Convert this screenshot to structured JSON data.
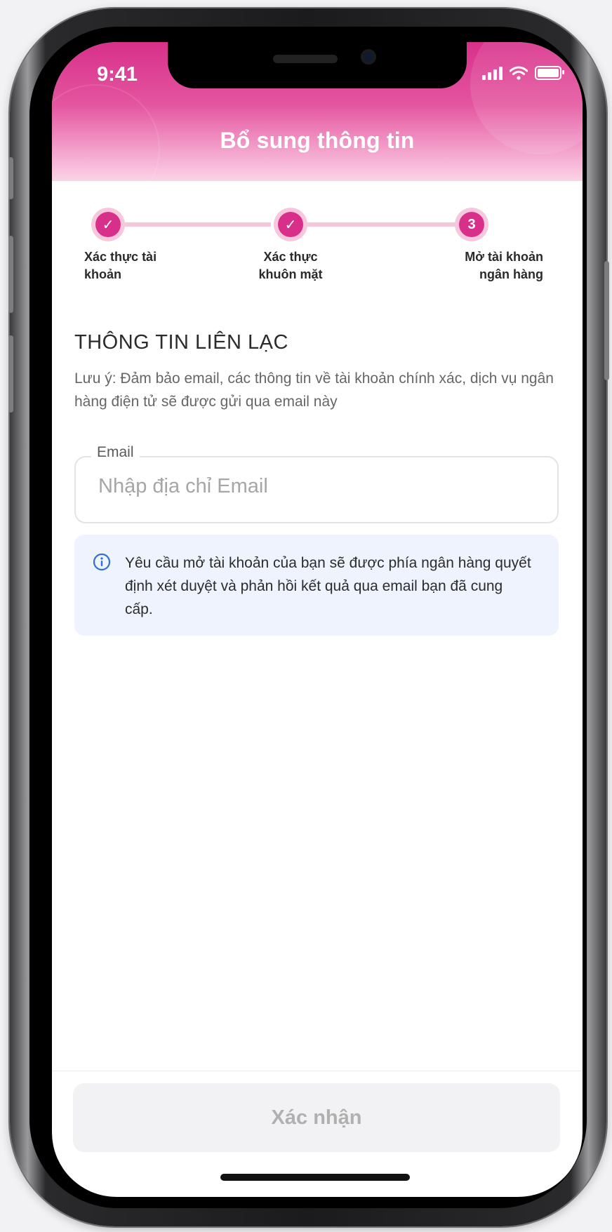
{
  "status_bar": {
    "time": "9:41"
  },
  "header": {
    "title": "Bổ sung thông tin",
    "gradient_top": "#d8308a",
    "gradient_bottom": "#fbd3e6"
  },
  "stepper": {
    "steps": [
      {
        "state": "done",
        "marker": "✓",
        "label_line1": "Xác thực tài",
        "label_line2": "khoản"
      },
      {
        "state": "done",
        "marker": "✓",
        "label_line1": "Xác thực",
        "label_line2": "khuôn mặt"
      },
      {
        "state": "current",
        "marker": "3",
        "label_line1": "Mở tài khoản",
        "label_line2": "ngân hàng"
      }
    ],
    "accent": "#d8308a",
    "track": "#f7c7dc"
  },
  "section": {
    "title": "THÔNG TIN LIÊN LẠC",
    "note": "Lưu ý: Đảm bảo email, các thông tin về tài khoản chính xác, dịch vụ ngân hàng điện tử sẽ được gửi qua email này"
  },
  "email_field": {
    "label": "Email",
    "placeholder": "Nhập địa chỉ Email",
    "value": ""
  },
  "info": {
    "icon": "info-icon",
    "text": "Yêu cầu mở tài khoản của bạn sẽ được phía ngân hàng quyết định xét duyệt và phản hồi kết quả qua email bạn đã cung cấp."
  },
  "footer": {
    "confirm_label": "Xác nhận",
    "confirm_enabled": false
  }
}
